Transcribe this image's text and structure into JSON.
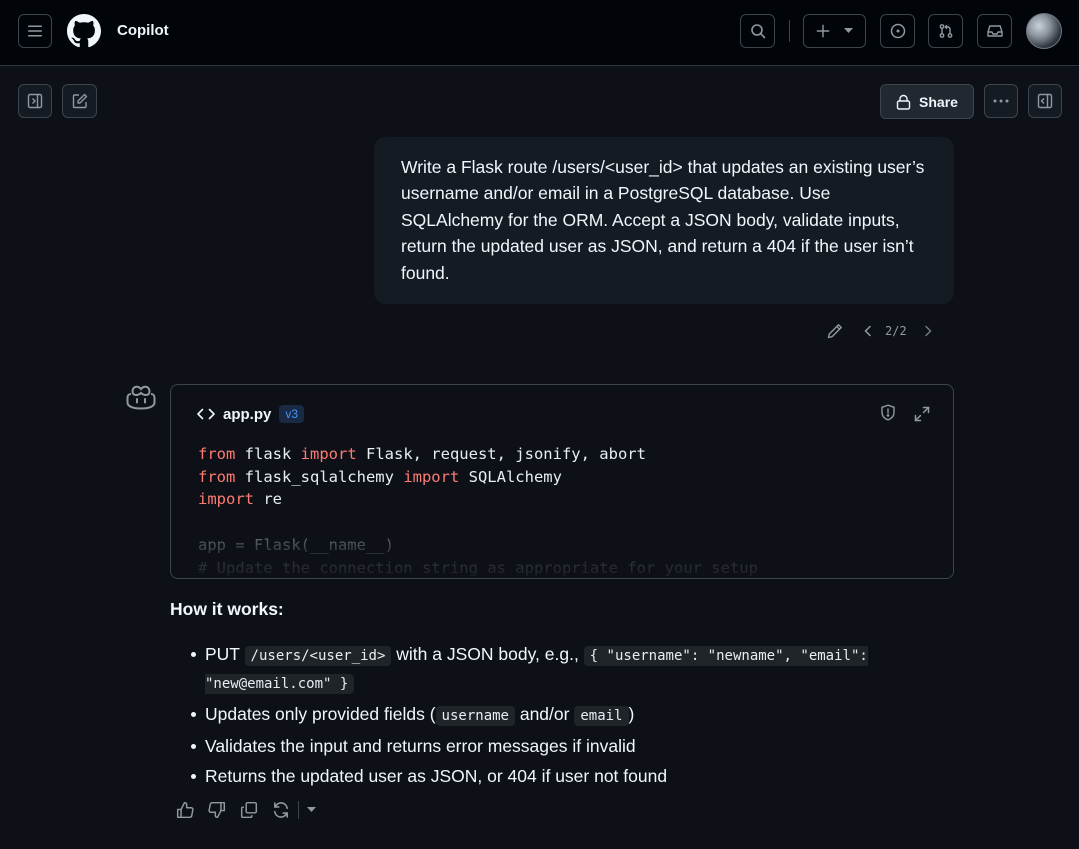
{
  "header": {
    "title": "Copilot"
  },
  "toolbar": {
    "share_label": "Share"
  },
  "user_message": {
    "text": "Write a Flask route /users/<user_id> that updates an existing user’s username and/or email in a PostgreSQL database. Use SQLAlchemy for the ORM. Accept a JSON body, validate inputs, return the updated user as JSON, and return a 404 if the user isn’t found.",
    "pager": "2/2"
  },
  "code_block": {
    "filename": "app.py",
    "version": "v3",
    "lines": [
      [
        {
          "t": "from",
          "k": true
        },
        {
          "t": " flask "
        },
        {
          "t": "import",
          "k": true
        },
        {
          "t": " Flask, request, jsonify, abort"
        }
      ],
      [
        {
          "t": "from",
          "k": true
        },
        {
          "t": " flask_sqlalchemy "
        },
        {
          "t": "import",
          "k": true
        },
        {
          "t": " SQLAlchemy"
        }
      ],
      [
        {
          "t": "import",
          "k": true
        },
        {
          "t": " re"
        }
      ],
      [
        {
          "t": ""
        }
      ],
      [
        {
          "t": "app = Flask(__name__)"
        }
      ],
      [
        {
          "t": "# Update the connection string as appropriate for your setup"
        }
      ]
    ]
  },
  "explanation": {
    "heading": "How it works:",
    "bullets": [
      [
        {
          "t": "PUT "
        },
        {
          "c": "/users/<user_id>"
        },
        {
          "t": " with a JSON body, e.g., "
        },
        {
          "c": "{ \"username\": \"newname\", \"email\": \"new@email.com\" }"
        }
      ],
      [
        {
          "t": "Updates only provided fields ("
        },
        {
          "c": "username"
        },
        {
          "t": " and/or "
        },
        {
          "c": "email"
        },
        {
          "t": ")"
        }
      ],
      [
        {
          "t": "Validates the input and returns error messages if invalid"
        }
      ],
      [
        {
          "t": "Returns the updated user as JSON, or 404 if user not found"
        }
      ]
    ]
  },
  "icons": {
    "menu": "hamburger-menu-icon",
    "logo": "github-logo-icon",
    "search": "search-icon",
    "new": "plus-icon",
    "issues": "issue-circle-icon",
    "pulls": "pull-request-icon",
    "inbox": "inbox-icon"
  }
}
